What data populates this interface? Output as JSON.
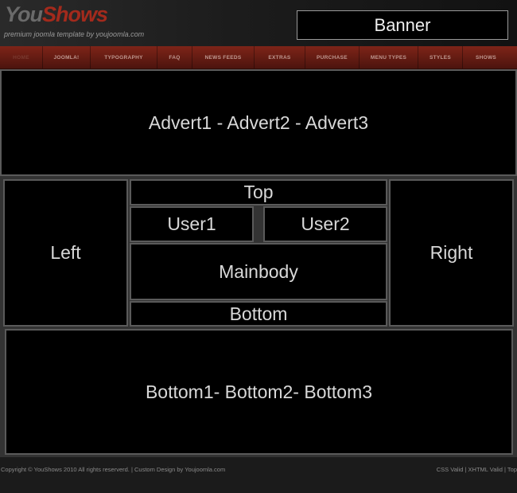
{
  "header": {
    "logo_part1": "You",
    "logo_part2": "Shows",
    "tagline": "premium joomla template by youjoomla.com",
    "banner": "Banner"
  },
  "nav": {
    "items": [
      "HOME",
      "JOOMLA!",
      "TYPOGRAPHY",
      "FAQ",
      "NEWS FEEDS",
      "EXTRAS",
      "PURCHASE",
      "MENU TYPES",
      "STYLES",
      "SHOWS"
    ]
  },
  "positions": {
    "advert": "Advert1 - Advert2 - Advert3",
    "left": "Left",
    "right": "Right",
    "top": "Top",
    "user1": "User1",
    "user2": "User2",
    "mainbody": "Mainbody",
    "bottom": "Bottom",
    "bottom_row": "Bottom1- Bottom2- Bottom3"
  },
  "footer": {
    "copyright": "Copyright © YouShows 2010 All rights reserverd. | Custom Design by Youjoomla.com",
    "links": [
      "CSS Valid",
      "XHTML Valid",
      "Top"
    ]
  },
  "colors": {
    "brand_red": "#a32a1c",
    "nav_bg": "#6b1e14",
    "module_bg": "#000000",
    "module_border": "#5a5a5a"
  }
}
